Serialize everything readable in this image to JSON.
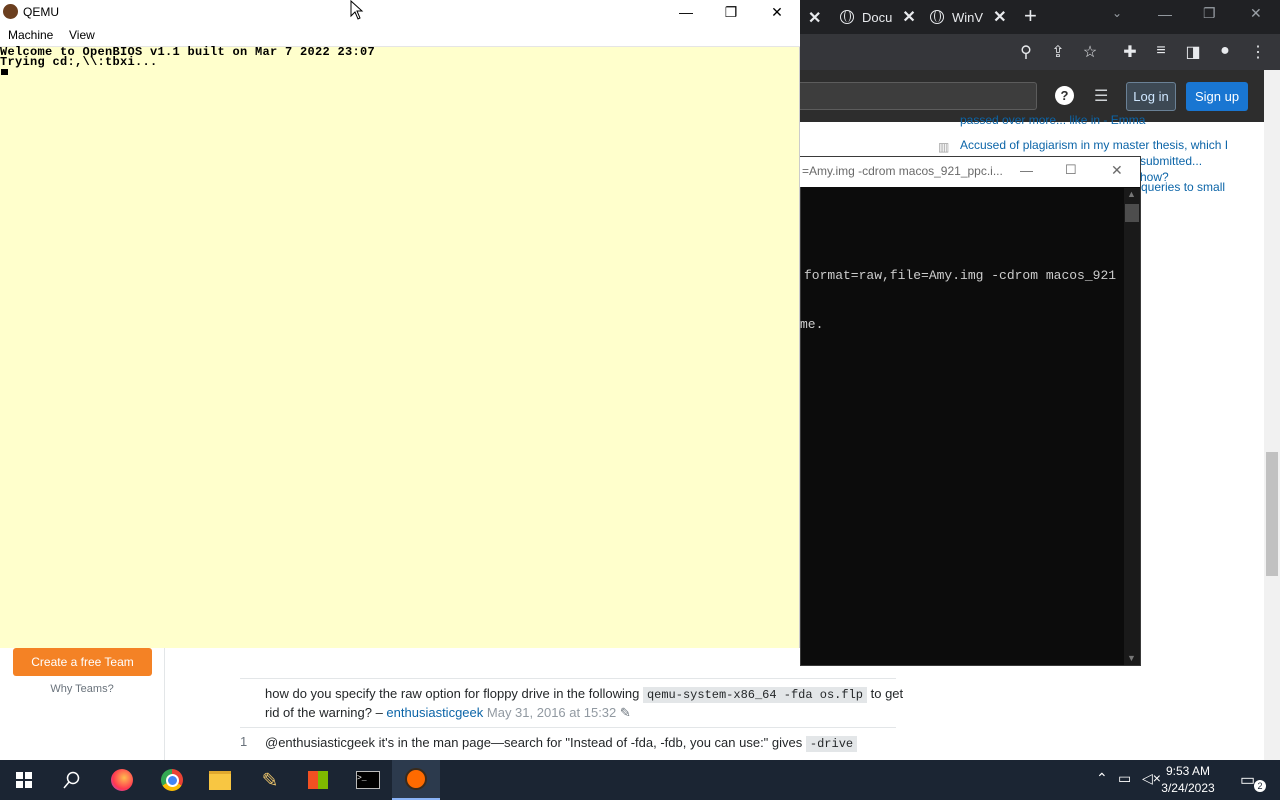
{
  "qemu": {
    "title": "QEMU",
    "menu": [
      "Machine",
      "View"
    ],
    "console_lines": [
      "Welcome to OpenBIOS v1.1 built on Mar 7 2022 23:07",
      "Trying cd:,\\\\:tbxi..."
    ],
    "colors": {
      "screen_bg": "#ffffcc"
    }
  },
  "browser": {
    "tabs": [
      {
        "label": "Docu",
        "icon": "globe-icon"
      },
      {
        "label": "WinV",
        "icon": "globe-icon"
      }
    ],
    "new_tab_symbol": "+",
    "header": {
      "login_label": "Log in",
      "signup_label": "Sign up"
    },
    "hot_questions": [
      "passed over more... like in - Emma",
      "Accused of plagiarism in my master thesis, which I",
      "submitted... how?",
      "queries to small"
    ]
  },
  "terminal": {
    "title": "=Amy.img -cdrom macos_921_ppc.i...",
    "lines": [
      "format=raw,file=Amy.img -cdrom macos_921",
      "me."
    ]
  },
  "so_sidebar": {
    "create_team_label": "Create a free Team",
    "why_teams_label": "Why Teams?"
  },
  "comments": [
    {
      "text_before": "how do you specify the raw option for floppy drive in the following",
      "code": "qemu-system-x86_64 -fda os.flp",
      "text_after": "to get rid of the warning? –",
      "user": "enthusiasticgeek",
      "timestamp": "May 31, 2016 at 15:32"
    },
    {
      "score": "1",
      "text_before": "@enthusiasticgeek it's in the man page—search for \"Instead of -fda, -fdb, you can use:\" gives",
      "code": "-drive"
    }
  ],
  "taskbar": {
    "time": "9:53 AM",
    "date": "3/24/2023",
    "notification_count": "2"
  }
}
